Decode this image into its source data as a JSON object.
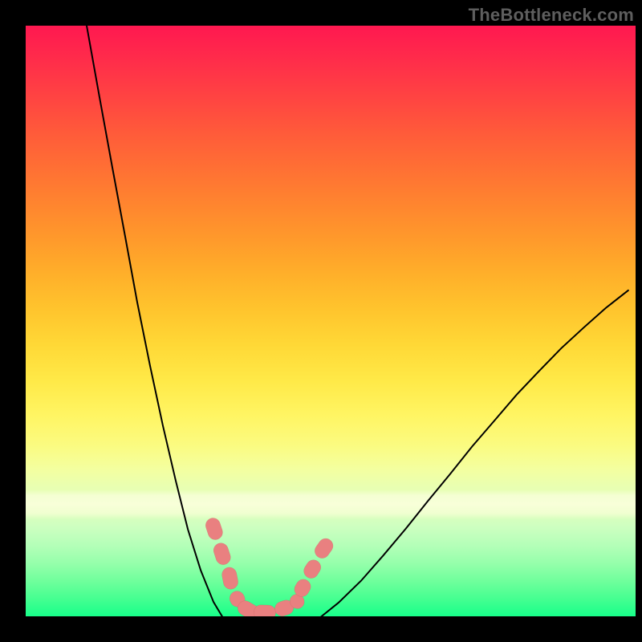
{
  "watermark": "TheBottleneck.com",
  "colors": {
    "frame": "#000000",
    "curve_stroke": "#000000",
    "segment_fill": "#e98080",
    "segment_stroke": "#c85e5e"
  },
  "chart_data": {
    "type": "line",
    "title": "",
    "xlabel": "",
    "ylabel": "",
    "xlim": [
      0,
      100
    ],
    "ylim": [
      0,
      100
    ],
    "grid": false,
    "legend": false,
    "note": "No axes, ticks, or labels are visible. X/Y are treated as 0–100% of the plot area. Y=0 at bottom, Y=100 at top.",
    "series": [
      {
        "name": "left_curve",
        "x": [
          10.0,
          12.1,
          14.2,
          16.3,
          18.3,
          20.4,
          22.5,
          24.6,
          26.6,
          28.7,
          30.8,
          32.9,
          34.5
        ],
        "values": [
          100.0,
          88.3,
          76.8,
          65.5,
          54.6,
          44.2,
          34.4,
          25.4,
          17.4,
          10.7,
          5.5,
          2.0,
          0.6
        ]
      },
      {
        "name": "bottom_curve",
        "x": [
          34.5,
          36.0,
          38.0,
          40.0,
          42.0,
          44.0
        ],
        "values": [
          0.6,
          0.1,
          0.0,
          0.0,
          0.1,
          0.6
        ]
      },
      {
        "name": "right_curve",
        "x": [
          44.0,
          47.7,
          51.3,
          55.0,
          58.6,
          62.3,
          65.9,
          69.6,
          73.2,
          76.9,
          80.5,
          84.2,
          87.8,
          91.5,
          95.1,
          98.8
        ],
        "values": [
          0.6,
          2.5,
          5.4,
          9.0,
          13.1,
          17.5,
          22.0,
          26.5,
          31.0,
          35.3,
          39.5,
          43.4,
          47.1,
          50.5,
          53.7,
          56.6
        ]
      }
    ],
    "annotations": {
      "bottom_segments": {
        "description": "Salmon-colored rounded segments along the valley of the V",
        "items": [
          {
            "cx": 30.9,
            "cy": 82.5,
            "length": 3.6,
            "angle_deg": 72
          },
          {
            "cx": 32.2,
            "cy": 86.6,
            "length": 3.6,
            "angle_deg": 72
          },
          {
            "cx": 33.5,
            "cy": 90.6,
            "length": 3.6,
            "angle_deg": 79
          },
          {
            "cx": 34.7,
            "cy": 94.0,
            "length": 2.6,
            "angle_deg": 63
          },
          {
            "cx": 36.5,
            "cy": 95.8,
            "length": 3.6,
            "angle_deg": 30
          },
          {
            "cx": 39.2,
            "cy": 96.2,
            "length": 3.6,
            "angle_deg": 2
          },
          {
            "cx": 42.4,
            "cy": 95.5,
            "length": 3.1,
            "angle_deg": -18
          },
          {
            "cx": 44.5,
            "cy": 94.4,
            "length": 2.3,
            "angle_deg": -42
          },
          {
            "cx": 45.4,
            "cy": 92.2,
            "length": 2.9,
            "angle_deg": -60
          },
          {
            "cx": 47.0,
            "cy": 89.1,
            "length": 3.1,
            "angle_deg": -58
          },
          {
            "cx": 48.9,
            "cy": 85.7,
            "length": 3.4,
            "angle_deg": -55
          }
        ]
      }
    }
  }
}
